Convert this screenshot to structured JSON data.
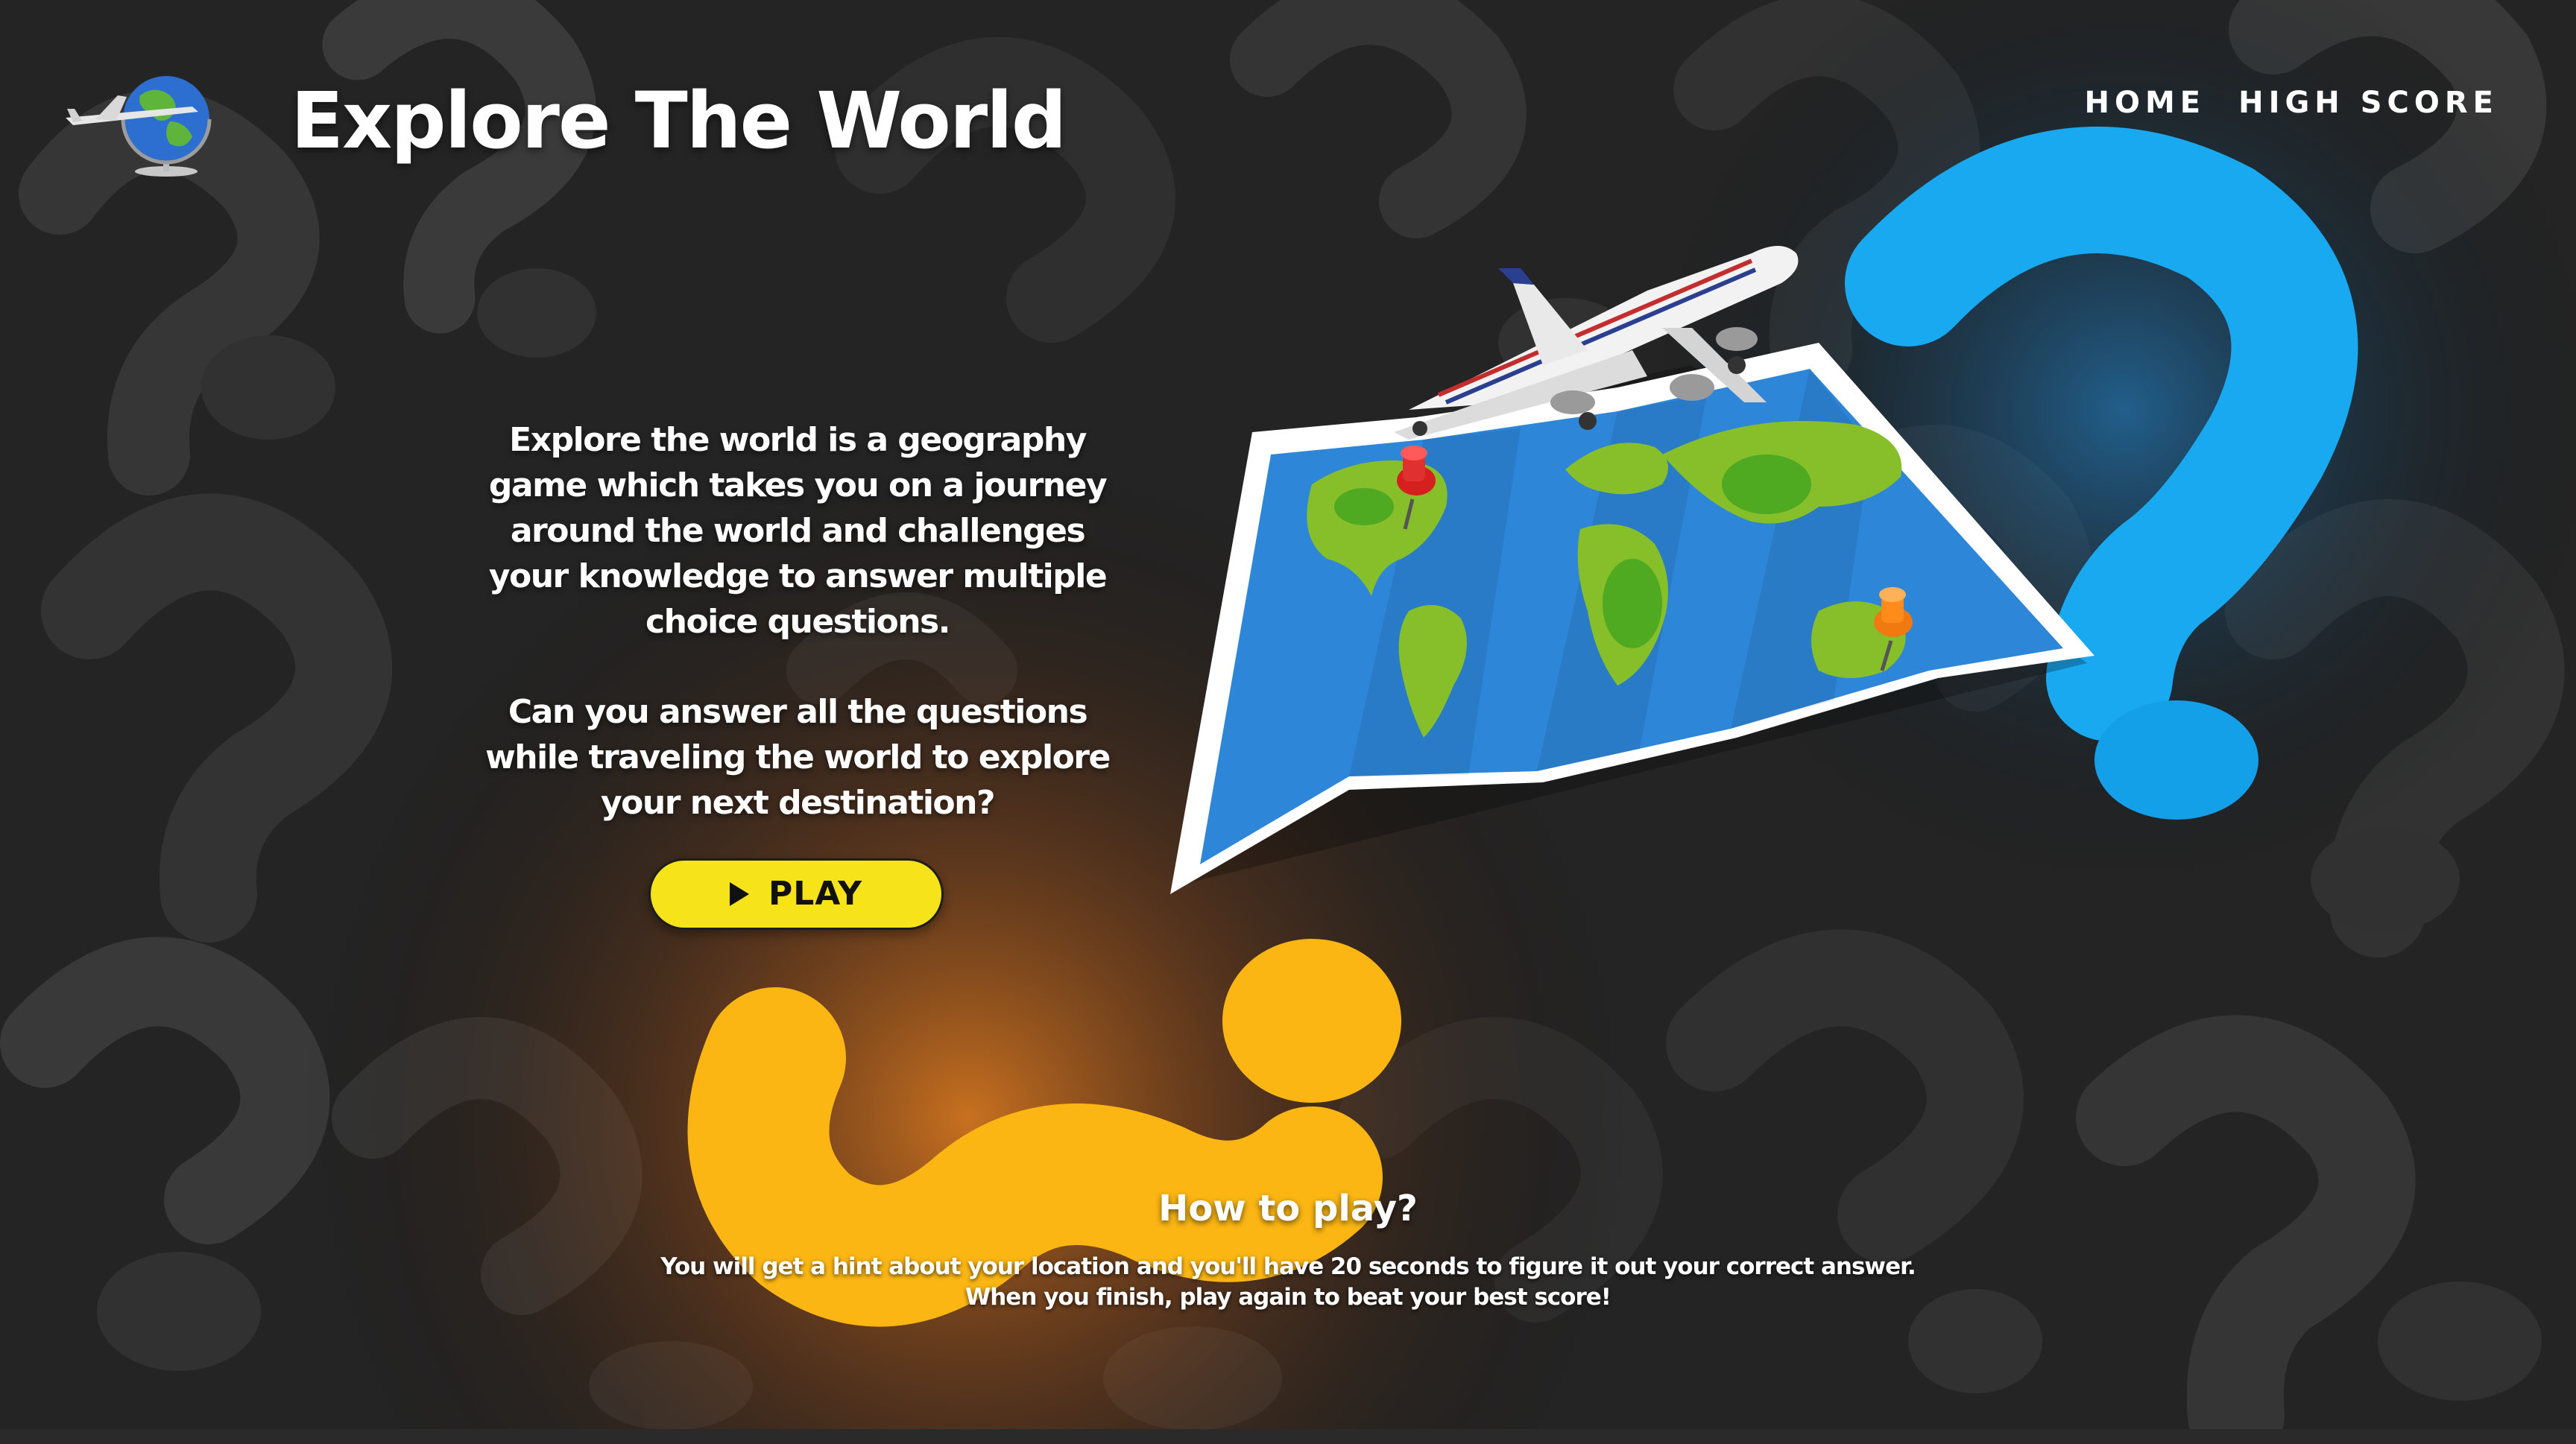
{
  "header": {
    "title": "Explore The World",
    "logo_icon": "globe-airplane-icon"
  },
  "nav": {
    "items": [
      {
        "label": "HOME"
      },
      {
        "label": "HIGH SCORE"
      }
    ]
  },
  "intro": {
    "description": "Explore the world is a geography game which takes you on a journey around the world and challenges your knowledge to answer multiple choice questions.",
    "question": "Can you answer all the questions while traveling the world to explore your next destination?"
  },
  "play_button": {
    "label": "PLAY",
    "icon": "play-icon",
    "color": "#f7e31a"
  },
  "how_to_play": {
    "title": "How to play?",
    "line1": "You will get a hint about your location and you'll have 20 seconds to figure it out your correct answer.",
    "line2": "When you finish, play again to beat your best score!"
  },
  "colors": {
    "background": "#1f1f1f",
    "accent_yellow": "#fbb614",
    "accent_blue": "#19a9f0",
    "map_blue": "#2a7fd0",
    "land_green": "#8cbf2a"
  }
}
